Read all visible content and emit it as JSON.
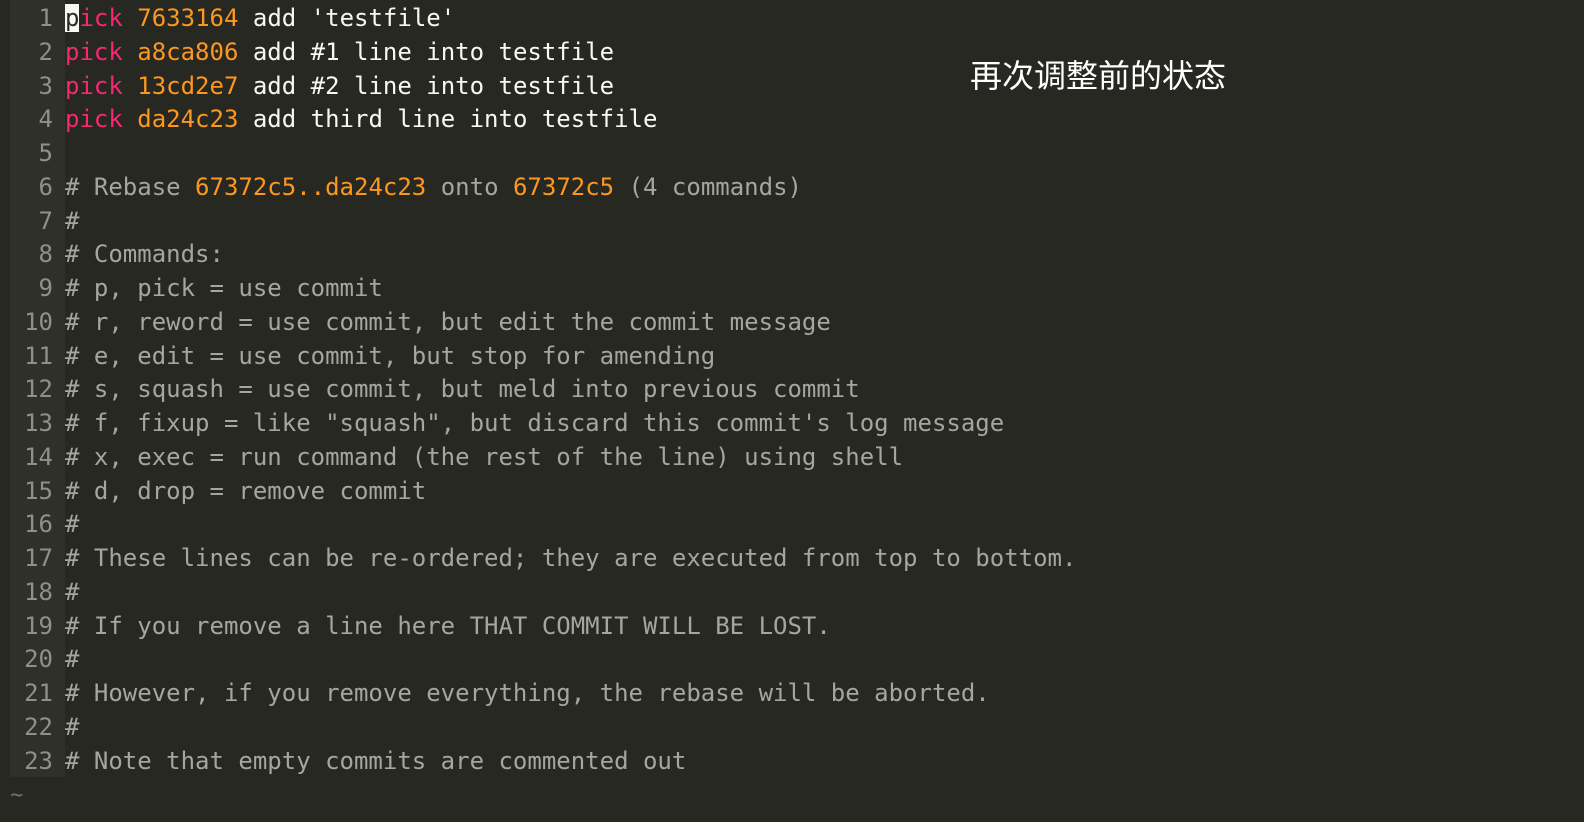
{
  "colors": {
    "background": "#272822",
    "keyword": "#f92672",
    "hash": "#fd971f",
    "text": "#f8f8f2",
    "comment": "#a6a69c",
    "line_number": "#8f908a"
  },
  "overlay": {
    "text": "再次调整前的状态"
  },
  "editor": {
    "tilde": "~",
    "lines": [
      {
        "num": "1",
        "cursor_char": "p",
        "keyword": "ick",
        "hash": "7633164",
        "msg": "add 'testfile'"
      },
      {
        "num": "2",
        "keyword": "pick",
        "hash": "a8ca806",
        "msg": "add #1 line into testfile"
      },
      {
        "num": "3",
        "keyword": "pick",
        "hash": "13cd2e7",
        "msg": "add #2 line into testfile"
      },
      {
        "num": "4",
        "keyword": "pick",
        "hash": "da24c23",
        "msg": "add third line into testfile"
      },
      {
        "num": "5"
      },
      {
        "num": "6",
        "c1": "# Rebase ",
        "h1": "67372c5",
        "c2": "..",
        "h2": "da24c23",
        "c3": " onto ",
        "h3": "67372c5",
        "c4": " (4 commands)"
      },
      {
        "num": "7",
        "text": "#"
      },
      {
        "num": "8",
        "text": "# Commands:"
      },
      {
        "num": "9",
        "text": "# p, pick = use commit"
      },
      {
        "num": "10",
        "text": "# r, reword = use commit, but edit the commit message"
      },
      {
        "num": "11",
        "text": "# e, edit = use commit, but stop for amending"
      },
      {
        "num": "12",
        "text": "# s, squash = use commit, but meld into previous commit"
      },
      {
        "num": "13",
        "text": "# f, fixup = like \"squash\", but discard this commit's log message"
      },
      {
        "num": "14",
        "text": "# x, exec = run command (the rest of the line) using shell"
      },
      {
        "num": "15",
        "text": "# d, drop = remove commit"
      },
      {
        "num": "16",
        "text": "#"
      },
      {
        "num": "17",
        "text": "# These lines can be re-ordered; they are executed from top to bottom."
      },
      {
        "num": "18",
        "text": "#"
      },
      {
        "num": "19",
        "text": "# If you remove a line here THAT COMMIT WILL BE LOST."
      },
      {
        "num": "20",
        "text": "#"
      },
      {
        "num": "21",
        "text": "# However, if you remove everything, the rebase will be aborted."
      },
      {
        "num": "22",
        "text": "#"
      },
      {
        "num": "23",
        "text": "# Note that empty commits are commented out"
      }
    ]
  }
}
